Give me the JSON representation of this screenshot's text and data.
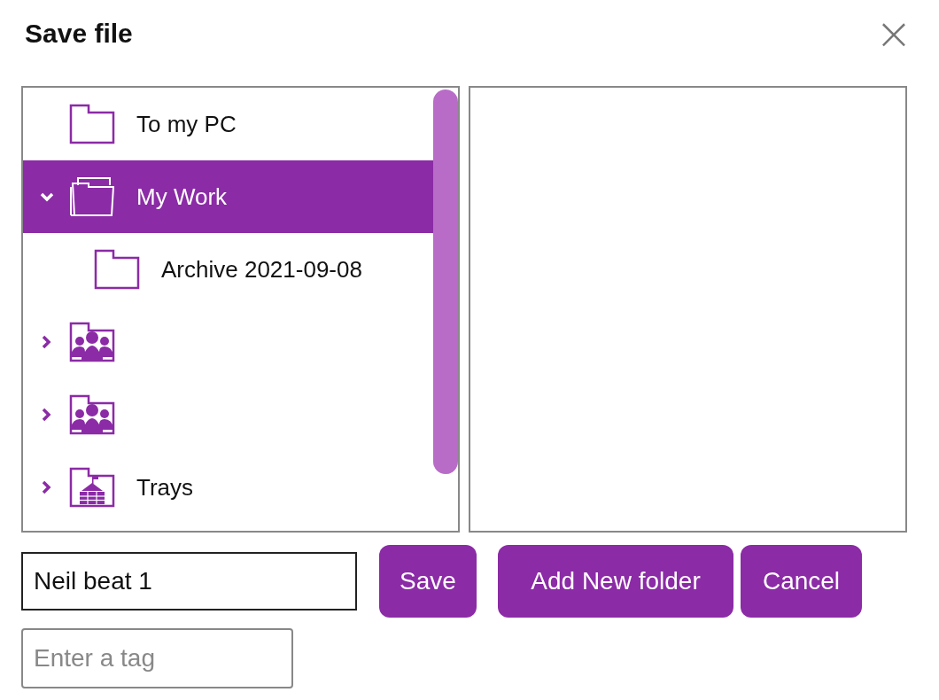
{
  "dialog": {
    "title": "Save file",
    "close": "×"
  },
  "tree": [
    {
      "kind": "folder",
      "label": "To my PC",
      "selected": false
    },
    {
      "kind": "open-folder",
      "label": "My Work",
      "expanded": true,
      "selected": true,
      "children": [
        {
          "kind": "folder",
          "label": "Archive 2021-09-08",
          "selected": false
        }
      ]
    },
    {
      "kind": "group-folder",
      "expanded": false,
      "selected": false
    },
    {
      "kind": "group-folder",
      "expanded": false,
      "selected": false
    },
    {
      "kind": "school-folder",
      "label": "Trays",
      "expanded": false,
      "selected": false
    }
  ],
  "filename": {
    "value": "Neil beat 1"
  },
  "buttons": [
    "Save",
    "Add New folder",
    "Cancel"
  ],
  "tag": {
    "placeholder": "Enter a tag"
  }
}
